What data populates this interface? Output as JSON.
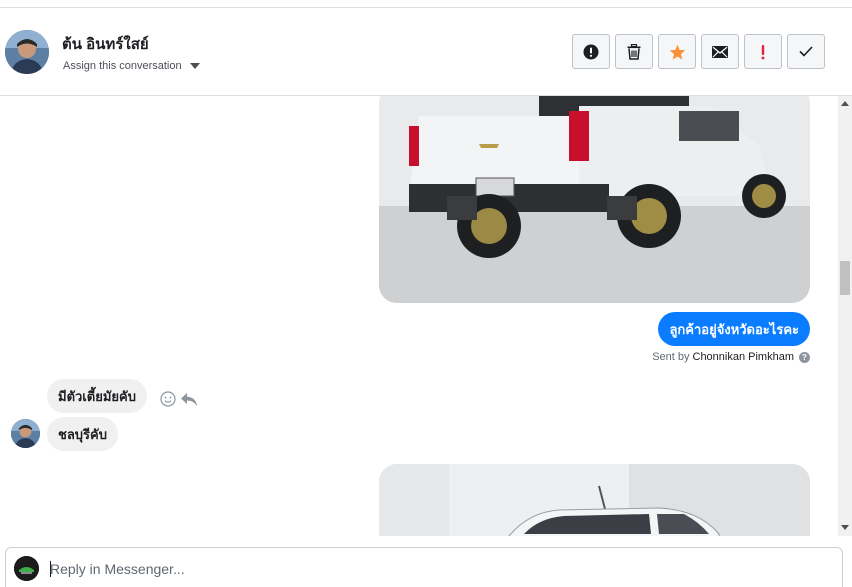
{
  "header": {
    "contact_name": "ต้น อินทร์ใสย์",
    "assign_label": "Assign this conversation"
  },
  "actions": [
    {
      "name": "mark-spam-button",
      "icon": "alert-circle-icon"
    },
    {
      "name": "delete-button",
      "icon": "trash-icon"
    },
    {
      "name": "star-button",
      "icon": "star-icon",
      "color": "#f7923b"
    },
    {
      "name": "mark-unread-button",
      "icon": "envelope-icon"
    },
    {
      "name": "important-button",
      "icon": "exclamation-icon",
      "color": "#e41e3f"
    },
    {
      "name": "mark-done-button",
      "icon": "checkmark-icon"
    }
  ],
  "messages": {
    "outgoing_text": "ลูกค้าอยู่จังหวัดอะไรคะ",
    "sent_by_prefix": "Sent by",
    "sent_by_name": "Chonnikan Pimkham",
    "incoming_1": "มีตัวเตี้ยมัยคับ",
    "incoming_2": "ชลบุรีคับ"
  },
  "composer": {
    "placeholder": "Reply in Messenger..."
  },
  "colors": {
    "accent": "#0a7cff",
    "incoming_bubble": "#f1f0f0",
    "star": "#f7923b",
    "important": "#e41e3f"
  }
}
